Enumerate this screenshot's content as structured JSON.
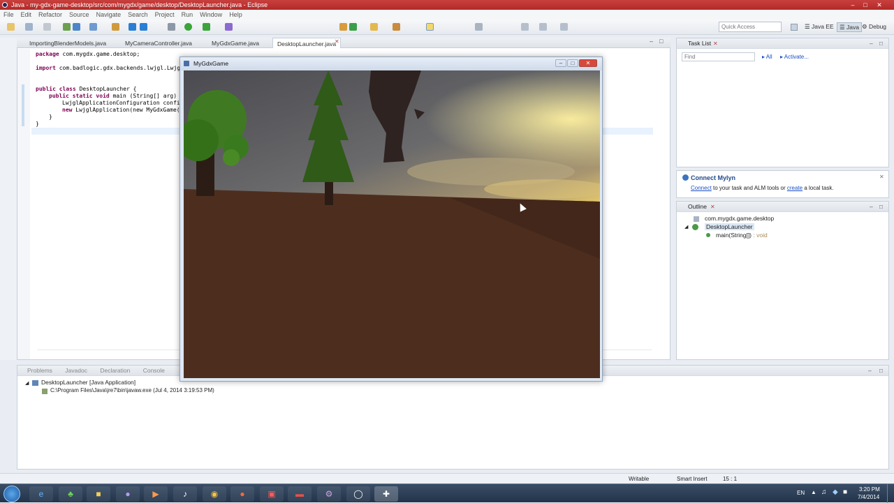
{
  "window": {
    "title": "Java - my-gdx-game-desktop/src/com/mygdx/game/desktop/DesktopLauncher.java - Eclipse"
  },
  "menu": [
    "File",
    "Edit",
    "Refactor",
    "Source",
    "Navigate",
    "Search",
    "Project",
    "Run",
    "Window",
    "Help"
  ],
  "toolbar": {
    "quick_access_placeholder": "Quick Access",
    "perspectives": [
      "Java EE",
      "Java",
      "Debug"
    ]
  },
  "editor": {
    "tabs": [
      "ImportingBlenderModels.java",
      "MyCameraController.java",
      "MyGdxGame.java",
      "DesktopLauncher.java"
    ],
    "active_tab": "DesktopLauncher.java",
    "code": {
      "line1_kw": "package",
      "line1_rest": " com.mygdx.game.desktop;",
      "line2_kw": "import",
      "line2_rest": " com.badlogic.gdx.backends.lwjgl.Lwjgl",
      "line3_kw": "public class",
      "line3_rest": " DesktopLauncher {",
      "line4_kw": "public static void",
      "line4_rest": " main (String[] arg) {",
      "line5": "LwjglApplicationConfiguration config",
      "line6_kw": "new",
      "line6_rest": " LwjglApplication(new MyGdxGame()",
      "line7": "}",
      "line8": "}"
    }
  },
  "game_window": {
    "title": "MyGdxGame"
  },
  "task_list": {
    "title": "Task List",
    "find_placeholder": "Find",
    "all_label": "All",
    "activate_label": "Activate..."
  },
  "mylyn": {
    "title": "Connect Mylyn",
    "connect": "Connect",
    "text1": " to your task and ALM tools or ",
    "create": "create",
    "text2": " a local task."
  },
  "outline": {
    "title": "Outline",
    "package": "com.mygdx.game.desktop",
    "class": "DesktopLauncher",
    "method": "main(String[])",
    "method_type": " : void"
  },
  "console": {
    "tabs": [
      "Problems",
      "Javadoc",
      "Declaration",
      "Console"
    ],
    "process": "DesktopLauncher [Java Application]",
    "path": "C:\\Program Files\\Java\\jre7\\bin\\javaw.exe (Jul 4, 2014 3:19:53 PM)"
  },
  "status": {
    "writable": "Writable",
    "insert": "Smart Insert",
    "position": "15 : 1"
  },
  "taskbar": {
    "lang": "EN",
    "time": "3:20 PM",
    "date": "7/4/2014"
  },
  "colors": {
    "title_red": "#b22a28",
    "ground": "#4d2e1e",
    "tree_green": "#3f6a1f",
    "link_blue": "#1a4ec8"
  }
}
